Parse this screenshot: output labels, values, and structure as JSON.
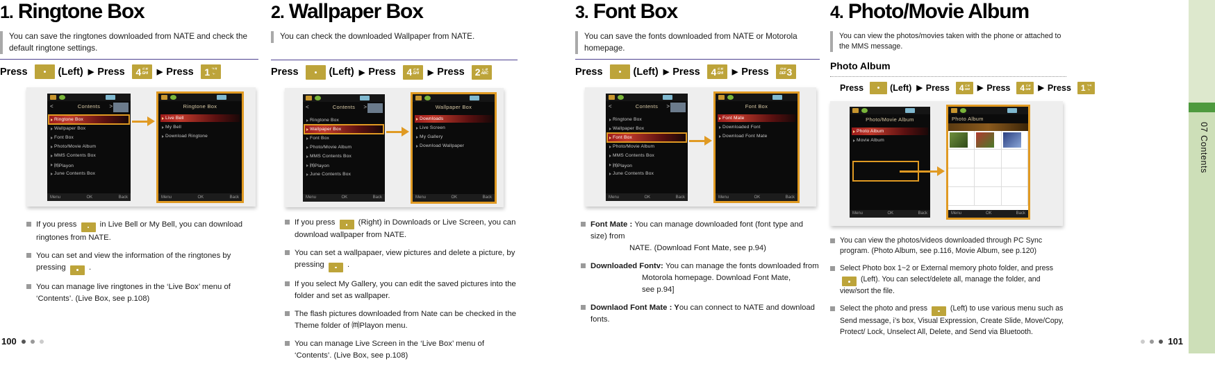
{
  "sidebar": {
    "label": "07 Contents"
  },
  "footer": {
    "left_page": "100",
    "right_page": "101"
  },
  "columns": [
    {
      "number": "1.",
      "title": "Ringtone Box",
      "intro": "You can save the ringtones downloaded from NATE and check the default ringtone settings.",
      "press_label": "Press",
      "press_left": "(Left)",
      "keys": [
        {
          "type": "dot"
        },
        {
          "type": "digit",
          "digit": "4",
          "sub1": "ㄷㅌ",
          "sub2": "GHI"
        },
        {
          "type": "digit",
          "digit": "1",
          "sub1": "ㄱㅋ",
          "sub2": "-,."
        }
      ],
      "figure": {
        "left_phone": {
          "title": "Contents",
          "nav_left": "<",
          "nav_right": ">",
          "rows": [
            "Ringtone Box",
            "Wallpaper Box",
            "Font Box",
            "Photo/Movie Album",
            "MMS Contents Box",
            "⒨Playon",
            "June Contents Box"
          ],
          "selected_index": 0,
          "bar": [
            "Menu",
            "OK",
            "Back"
          ]
        },
        "right_phone": {
          "title": "Ringtone Box",
          "rows": [
            "Live Bell",
            "My Bell",
            "Download Ringtone"
          ],
          "selected_index": 0,
          "bar": [
            "Menu",
            "OK",
            "Back"
          ]
        }
      },
      "bullets": [
        {
          "pre": "If you press ",
          "key": true,
          "post": " in Live Bell or My Bell, you can download ringtones from NATE."
        },
        {
          "pre": "You can set and view the information of the ringtones by pressing ",
          "key": true,
          "post": " ."
        },
        {
          "pre": "You can manage live ringtones in the ‘Live Box’ menu of ‘Contents’. (Live Box, see p.108)",
          "key": false,
          "post": ""
        }
      ]
    },
    {
      "number": "2.",
      "title": "Wallpaper Box",
      "intro": "You can check the downloaded Wallpaper from NATE.",
      "press_label": "Press",
      "press_left": "(Left)",
      "keys": [
        {
          "type": "dot"
        },
        {
          "type": "digit",
          "digit": "4",
          "sub1": "ㄷㅌ",
          "sub2": "GHI"
        },
        {
          "type": "digit",
          "digit": "2",
          "sub1": "ㄴㄹ",
          "sub2": "ABC"
        }
      ],
      "figure": {
        "left_phone": {
          "title": "Contents",
          "nav_left": "<",
          "nav_right": ">",
          "rows": [
            "Ringtone Box",
            "Wallpaper Box",
            "Font Box",
            "Photo/Movie Album",
            "MMS Contents Box",
            "⒨Playon",
            "June Contents Box"
          ],
          "selected_index": 1,
          "bar": [
            "Menu",
            "OK",
            "Back"
          ]
        },
        "right_phone": {
          "title": "Wallpaper Box",
          "rows": [
            "Downloads",
            "Live Screen",
            "My Gallery",
            "Download Wallpaper"
          ],
          "selected_index": 0,
          "bar": [
            "Menu",
            "OK",
            "Back"
          ]
        }
      },
      "bullets": [
        {
          "pre": "If you press ",
          "key": true,
          "post": " (Right) in Downloads or Live Screen, you can download wallpaper from NATE."
        },
        {
          "pre": "You can set a wallpapaer, view pictures and delete a picture, by pressing ",
          "key": true,
          "post": " ."
        },
        {
          "pre": "If you select My Gallery, you can edit the saved pictures into the folder and set as wallpaper.",
          "key": false,
          "post": ""
        },
        {
          "pre": "The flash pictures downloaded from Nate can be checked in the Theme folder of ⒨Playon menu.",
          "key": false,
          "post": ""
        },
        {
          "pre": "You can manage Live Screen in the ‘Live Box’ menu of ‘Contents’. (Live Box, see p.108)",
          "key": false,
          "post": ""
        }
      ]
    },
    {
      "number": "3.",
      "title": "Font Box",
      "intro": "You can save the fonts downloaded from NATE or Motorola homepage.",
      "press_label": "Press",
      "press_left": "(Left)",
      "keys": [
        {
          "type": "dot"
        },
        {
          "type": "digit",
          "digit": "4",
          "sub1": "ㄷㅌ",
          "sub2": "GHI"
        },
        {
          "type": "digit-pre",
          "digit": "3",
          "sub1": "ㅁㅂ",
          "sub2": "DEF"
        }
      ],
      "figure": {
        "left_phone": {
          "title": "Contents",
          "nav_left": "<",
          "nav_right": ">",
          "rows": [
            "Ringtone Box",
            "Wallpaper Box",
            "Font Box",
            "Photo/Movie Album",
            "MMS Contents Box",
            "⒨Playon",
            "June Contents Box"
          ],
          "selected_index": 2,
          "bar": [
            "Menu",
            "OK",
            "Back"
          ]
        },
        "right_phone": {
          "title": "Font Box",
          "rows": [
            "Font Mate",
            "Downloaded Font",
            "Download Font Mate"
          ],
          "selected_index": 0,
          "bar": [
            "Menu",
            "OK",
            "Back"
          ]
        }
      },
      "bullets": [
        {
          "bold": "Font Mate : ",
          "text": "You can manage downloaded font (font type and size) from",
          "cont": "NATE. (Download Font Mate, see p.94)"
        },
        {
          "bold": "Downloaded Fontv: ",
          "text": "You can manage the fonts downloaded from",
          "cont": "Motorola homepage.  Download Font Mate,",
          "cont2": "see p.94]"
        },
        {
          "bold": "Downlaod Font Mate : Y",
          "text": "ou can connect to NATE and download fonts."
        }
      ]
    },
    {
      "number": "4.",
      "title": "Photo/Movie Album",
      "intro": "You can view the photos/movies taken with the phone or attached to the MMS message.",
      "subhead": "Photo Album",
      "press_label": "Press",
      "press_left": "(Left)",
      "keys": [
        {
          "type": "dot"
        },
        {
          "type": "digit",
          "digit": "4",
          "sub1": "ㄷㅌ",
          "sub2": "GHI"
        },
        {
          "type": "digit",
          "digit": "4",
          "sub1": "ㄷㅌ",
          "sub2": "GHI"
        },
        {
          "type": "digit",
          "digit": "1",
          "sub1": "ㄱㅋ",
          "sub2": "-,."
        }
      ],
      "figure": {
        "left_phone": {
          "title": "Photo/Movie Album",
          "rows": [
            "Photo Album",
            "Movie Album"
          ],
          "selected_index": 0,
          "bar": [
            "Menu",
            "OK",
            "Back"
          ]
        },
        "right_phone": {
          "title": "Photo Album",
          "bar": [
            "Menu",
            "OK",
            "Back"
          ]
        }
      },
      "bullets": [
        {
          "pre": "You can view the photos/videos downloaded through PC Sync program. (Photo Album, see p.116, Movie Album, see p.120)",
          "key": false,
          "post": ""
        },
        {
          "pre": "Select Photo box 1~2 or External memory photo folder, and press ",
          "key": true,
          "post": " (Left). You can select/delete all, manage the folder, and view/sort the file."
        },
        {
          "pre": "Select the photo and press ",
          "key": true,
          "post": " (Left) to use various menu such as Send message, i’s box, Visual Expression, Create Slide, Move/Copy, Protect/ Lock, Unselect All, Delete, and Send via Bluetooth."
        }
      ]
    }
  ]
}
